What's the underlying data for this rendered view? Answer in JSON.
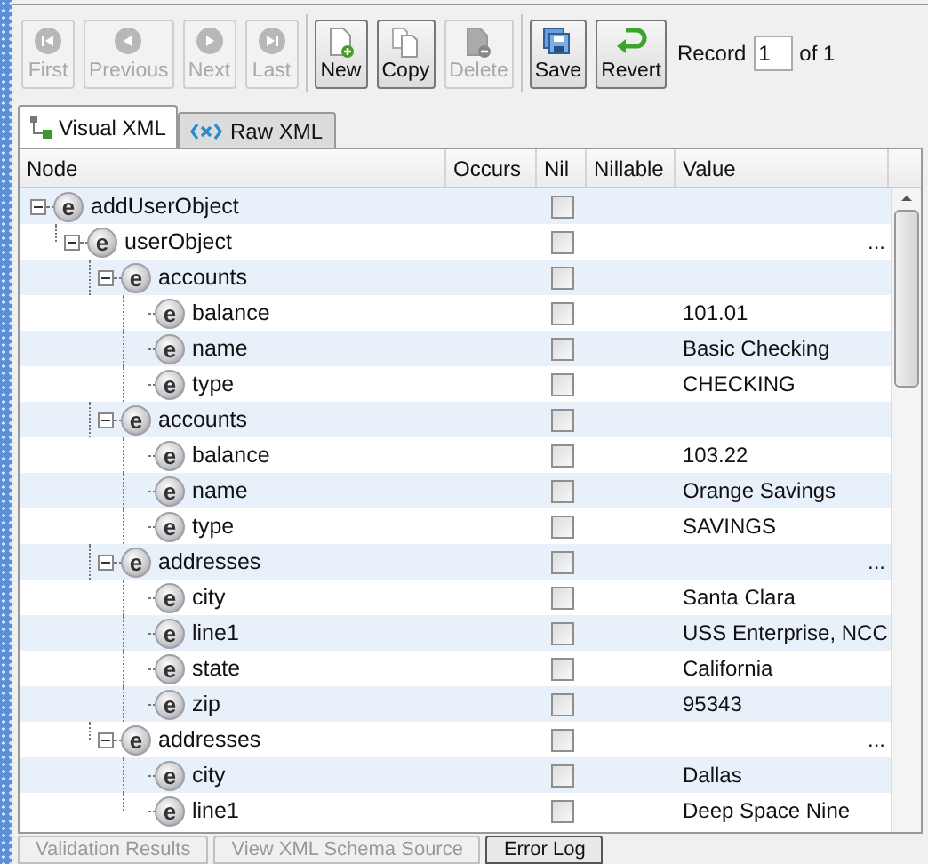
{
  "toolbar": {
    "buttons": [
      {
        "label": "First",
        "kind": "first",
        "disabled": true
      },
      {
        "label": "Previous",
        "kind": "previous",
        "disabled": true
      },
      {
        "label": "Next",
        "kind": "next",
        "disabled": true
      },
      {
        "label": "Last",
        "kind": "last",
        "disabled": true
      },
      {
        "label": "New",
        "kind": "new",
        "disabled": false
      },
      {
        "label": "Copy",
        "kind": "copy",
        "disabled": false
      },
      {
        "label": "Delete",
        "kind": "delete",
        "disabled": true
      },
      {
        "label": "Save",
        "kind": "save",
        "disabled": false
      },
      {
        "label": "Revert",
        "kind": "revert",
        "disabled": false
      }
    ],
    "record_label": "Record",
    "record_value": "1",
    "record_total": "of 1"
  },
  "tabs": [
    {
      "label": "Visual XML",
      "kind": "tree",
      "selected": true
    },
    {
      "label": "Raw XML",
      "kind": "xml",
      "selected": false
    }
  ],
  "table": {
    "columns": [
      "Node",
      "Occurs",
      "Nil",
      "Nillable",
      "Value"
    ],
    "nodes": [
      {
        "name": "addUserObject",
        "badge": "e",
        "nil": false,
        "expanded": true,
        "children": [
          {
            "name": "userObject",
            "badge": "e",
            "nil": false,
            "expanded": true,
            "action": "...",
            "children": [
              {
                "name": "accounts",
                "badge": "e",
                "nil": false,
                "expanded": true,
                "children": [
                  {
                    "name": "balance",
                    "badge": "e",
                    "nil": false,
                    "value": "101.01"
                  },
                  {
                    "name": "name",
                    "badge": "e",
                    "nil": false,
                    "value": "Basic Checking"
                  },
                  {
                    "name": "type",
                    "badge": "e",
                    "nil": false,
                    "value": "CHECKING"
                  }
                ]
              },
              {
                "name": "accounts",
                "badge": "e",
                "nil": false,
                "expanded": true,
                "children": [
                  {
                    "name": "balance",
                    "badge": "e",
                    "nil": false,
                    "value": "103.22"
                  },
                  {
                    "name": "name",
                    "badge": "e",
                    "nil": false,
                    "value": "Orange Savings"
                  },
                  {
                    "name": "type",
                    "badge": "e",
                    "nil": false,
                    "value": "SAVINGS"
                  }
                ]
              },
              {
                "name": "addresses",
                "badge": "e",
                "nil": false,
                "expanded": true,
                "action": "...",
                "children": [
                  {
                    "name": "city",
                    "badge": "e",
                    "nil": false,
                    "value": "Santa Clara"
                  },
                  {
                    "name": "line1",
                    "badge": "e",
                    "nil": false,
                    "value": "USS Enterprise, NCC"
                  },
                  {
                    "name": "state",
                    "badge": "e",
                    "nil": false,
                    "value": "California"
                  },
                  {
                    "name": "zip",
                    "badge": "e",
                    "nil": false,
                    "value": "95343"
                  }
                ]
              },
              {
                "name": "addresses",
                "badge": "e",
                "nil": false,
                "expanded": true,
                "action": "...",
                "children": [
                  {
                    "name": "city",
                    "badge": "e",
                    "nil": false,
                    "value": "Dallas"
                  },
                  {
                    "name": "line1",
                    "badge": "e",
                    "nil": false,
                    "value": "Deep Space Nine"
                  }
                ]
              }
            ]
          }
        ]
      }
    ]
  },
  "bottom_tabs": [
    {
      "label": "Validation Results",
      "selected": false
    },
    {
      "label": "View XML Schema Source",
      "selected": false
    },
    {
      "label": "Error Log",
      "selected": true
    }
  ]
}
